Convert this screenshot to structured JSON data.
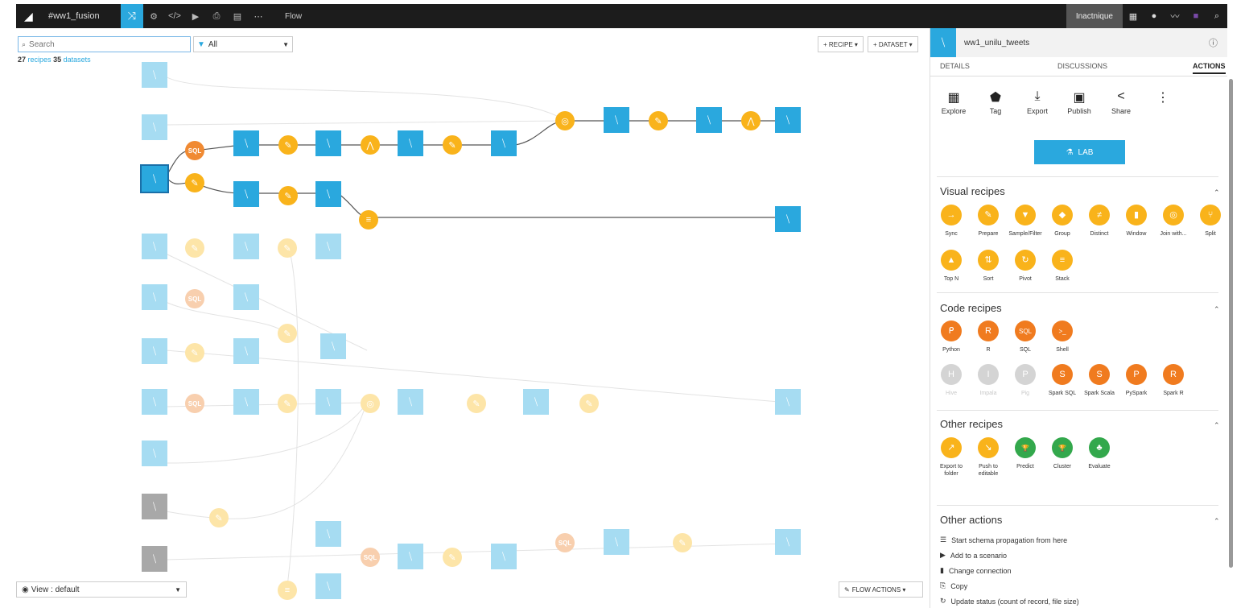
{
  "topbar": {
    "project": "#ww1_fusion",
    "title": "Flow",
    "user": "Inactnique",
    "icons": [
      "flow-icon",
      "settings-icon",
      "code-icon",
      "play-icon",
      "notebook-icon",
      "dashboard-icon",
      "more-icon"
    ],
    "right_icons": [
      "apps-grid-icon",
      "help-icon",
      "activity-icon",
      "avatar",
      "search-icon"
    ]
  },
  "flow": {
    "search_placeholder": "Search",
    "filter_value": "All",
    "counts": {
      "recipes": "27",
      "recipes_label": "recipes",
      "datasets": "35",
      "datasets_label": "datasets"
    },
    "add_recipe": "+ RECIPE ▾",
    "add_dataset": "+ DATASET ▾",
    "view": "View : default",
    "flow_actions": "FLOW ACTIONS ▾"
  },
  "panel": {
    "dataset_name": "ww1_unilu_tweets",
    "tabs": [
      "DETAILS",
      "DISCUSSIONS",
      "ACTIONS"
    ],
    "actions": [
      {
        "label": "Explore",
        "icon": "▦"
      },
      {
        "label": "Tag",
        "icon": "⬟"
      },
      {
        "label": "Export",
        "icon": "⤓"
      },
      {
        "label": "Publish",
        "icon": "▣"
      },
      {
        "label": "Share",
        "icon": "<"
      }
    ],
    "more_icon": "⋮",
    "lab": "LAB",
    "visual_recipes": {
      "title": "Visual recipes",
      "items": [
        {
          "label": "Sync",
          "icon": "→"
        },
        {
          "label": "Prepare",
          "icon": "✎"
        },
        {
          "label": "Sample/Filter",
          "icon": "▼"
        },
        {
          "label": "Group",
          "icon": "◆"
        },
        {
          "label": "Distinct",
          "icon": "≠"
        },
        {
          "label": "Window",
          "icon": "▮"
        },
        {
          "label": "Join with...",
          "icon": "◎"
        },
        {
          "label": "Split",
          "icon": "⑂"
        },
        {
          "label": "Top N",
          "icon": "▲"
        },
        {
          "label": "Sort",
          "icon": "⇅"
        },
        {
          "label": "Pivot",
          "icon": "↻"
        },
        {
          "label": "Stack",
          "icon": "≡"
        }
      ]
    },
    "code_recipes": {
      "title": "Code recipes",
      "items": [
        {
          "label": "Python",
          "icon": "ᑭ"
        },
        {
          "label": "R",
          "icon": "R"
        },
        {
          "label": "SQL",
          "icon": "SQL"
        },
        {
          "label": "Shell",
          "icon": ">_"
        },
        {
          "label": "Hive",
          "icon": "H"
        },
        {
          "label": "Impala",
          "icon": "I"
        },
        {
          "label": "Pig",
          "icon": "P"
        },
        {
          "label": "Spark SQL",
          "icon": "S"
        },
        {
          "label": "Spark Scala",
          "icon": "S"
        },
        {
          "label": "PySpark",
          "icon": "P"
        },
        {
          "label": "Spark R",
          "icon": "R"
        }
      ]
    },
    "other_recipes": {
      "title": "Other recipes",
      "items": [
        {
          "label": "Export to folder",
          "icon": "↗"
        },
        {
          "label": "Push to editable",
          "icon": "↘"
        },
        {
          "label": "Predict",
          "icon": "🏆"
        },
        {
          "label": "Cluster",
          "icon": "🏆"
        },
        {
          "label": "Evaluate",
          "icon": "♣"
        }
      ]
    },
    "other_actions": {
      "title": "Other actions",
      "items": [
        {
          "label": "Start schema propagation from here",
          "icon": "☰"
        },
        {
          "label": "Add to a scenario",
          "icon": "▶"
        },
        {
          "label": "Change connection",
          "icon": "▮"
        },
        {
          "label": "Copy",
          "icon": "⎘"
        },
        {
          "label": "Update status (count of record, file size)",
          "icon": "↻"
        }
      ]
    }
  },
  "colors": {
    "accent": "#2aa8de",
    "visual": "#f9b31b",
    "code": "#f07b1f",
    "other": "#33a84c"
  }
}
